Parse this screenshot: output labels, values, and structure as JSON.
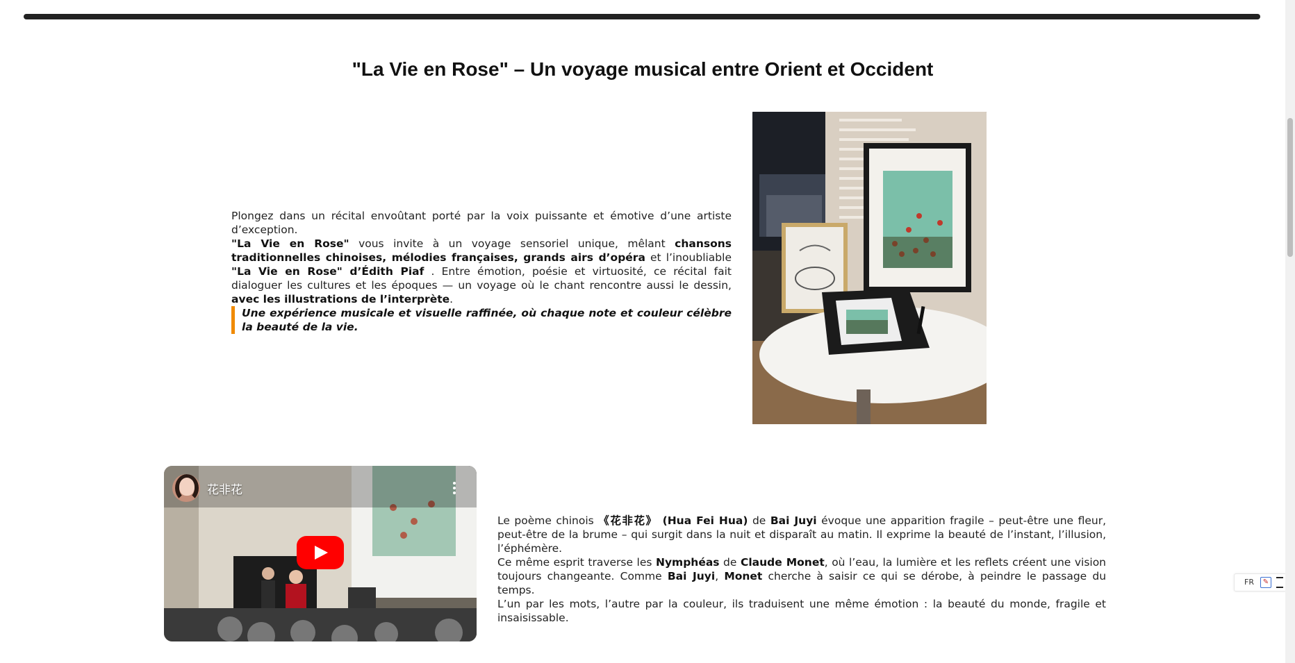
{
  "page": {
    "title": "\"La Vie en Rose\" – Un voyage musical entre Orient et Occident"
  },
  "intro": {
    "p1": "Plongez dans un récital envoûtant porté par la voix puissante et émotive d’une artiste d’exception.",
    "p2_a": "\"La Vie en Rose\"",
    "p2_b": " vous invite à un voyage sensoriel unique, mêlant ",
    "p2_c": "chansons traditionnelles chinoises, mélodies françaises, grands airs d’opéra",
    "p2_d": " et l’inoubliable ",
    "p2_e": "\"La Vie en Rose\" d’Édith Piaf",
    "p2_f": " . Entre émotion, poésie et virtuosité, ce récital fait dialoguer les cultures et les époques — un voyage où le chant rencontre aussi le dessin, ",
    "p2_g": "avec les illustrations de l’interprète",
    "p2_h": ".",
    "quote": "Une expérience musicale et visuelle raffinée, où chaque note et couleur célèbre la beauté de la vie."
  },
  "video": {
    "title": "花非花"
  },
  "poem": {
    "a1": "Le poème chinois ",
    "a2": "《花非花》 (Hua Fei Hua)",
    "a3": " de ",
    "a4": "Bai Juyi",
    "a5": " évoque une apparition fragile – peut-être une fleur, peut-être de la brume – qui surgit dans la nuit et disparaît au matin. Il exprime la beauté de l’instant, l’illusion, l’éphémère.",
    "b1": "Ce même esprit traverse les ",
    "b2": "Nymphéas",
    "b3": " de ",
    "b4": "Claude Monet",
    "b5": ", où l’eau, la lumière et les reflets créent une vision toujours changeante. Comme ",
    "b6": "Bai Juyi",
    "b7": ", ",
    "b8": "Monet",
    "b9": " cherche à saisir ce qui se dérobe, à peindre le passage du temps.",
    "c1": "L’un par les mots, l’autre par la couleur, ils traduisent une même émotion : la beauté du monde, fragile et insaisissable."
  },
  "lang_widget": {
    "code": "FR"
  },
  "colors": {
    "accent_bar": "#f08a00",
    "play_button": "#ff0000"
  }
}
